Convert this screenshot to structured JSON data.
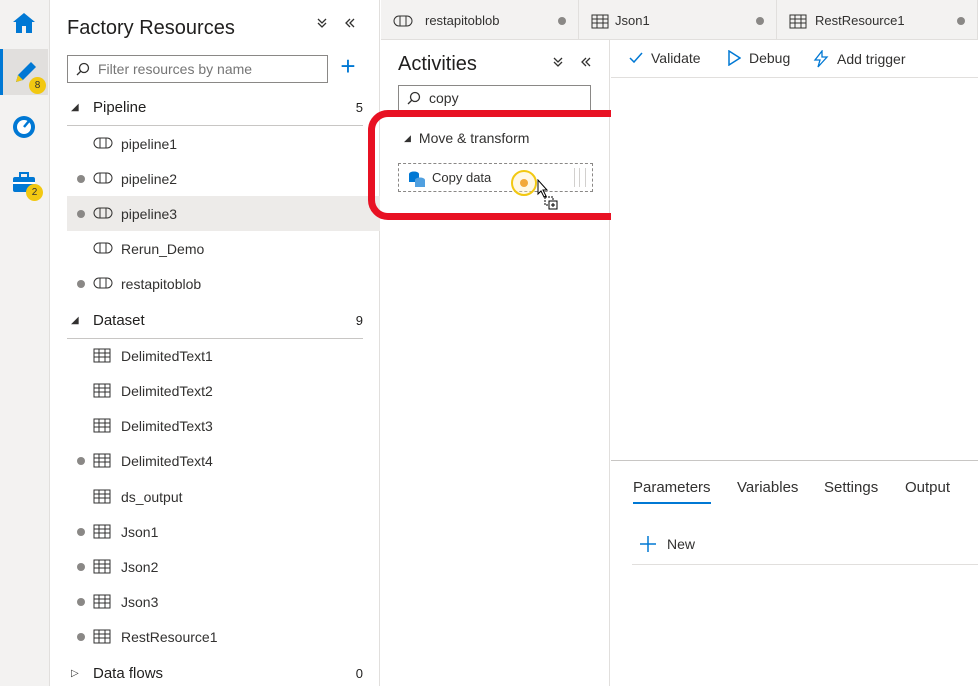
{
  "rail": {
    "badges": {
      "author": "8",
      "manage": "2"
    },
    "icons": [
      "home-icon",
      "pencil-icon",
      "monitor-icon",
      "toolbox-icon"
    ]
  },
  "resources": {
    "title": "Factory Resources",
    "filter_placeholder": "Filter resources by name",
    "sections": {
      "pipeline": {
        "label": "Pipeline",
        "count": "5"
      },
      "dataset": {
        "label": "Dataset",
        "count": "9"
      },
      "dataflows": {
        "label": "Data flows",
        "count": "0"
      }
    },
    "pipelines": [
      "pipeline1",
      "pipeline2",
      "pipeline3",
      "Rerun_Demo",
      "restapitoblob"
    ],
    "datasets": [
      "DelimitedText1",
      "DelimitedText2",
      "DelimitedText3",
      "DelimitedText4",
      "ds_output",
      "Json1",
      "Json2",
      "Json3",
      "RestResource1"
    ]
  },
  "tabs": [
    "restapitoblob",
    "Json1",
    "RestResource1"
  ],
  "activities": {
    "title": "Activities",
    "search_value": "copy",
    "category": "Move & transform",
    "item": "Copy data"
  },
  "toolbar": {
    "validate": "Validate",
    "debug": "Debug",
    "add_trigger": "Add trigger"
  },
  "bottom": {
    "tabs": [
      "Parameters",
      "Variables",
      "Settings",
      "Output"
    ],
    "new_label": "New"
  },
  "colors": {
    "accent": "#0078d4",
    "highlight": "#e81123",
    "badge": "#f2c811"
  }
}
